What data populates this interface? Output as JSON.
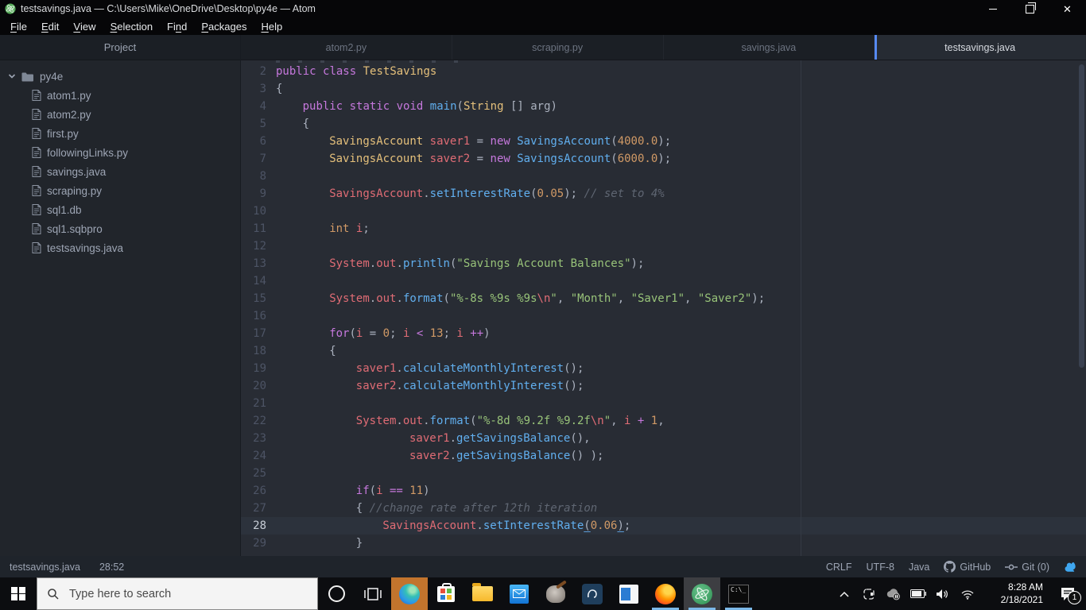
{
  "colors": {
    "accent_tab": "#568af2",
    "taskbar_underline": "#7cb8e8",
    "editor_bg": "#282c34",
    "sidebar_bg": "#21252b",
    "syntax": {
      "keyword": "#c678dd",
      "type": "#e5c07b",
      "function": "#61afef",
      "variable": "#e06c75",
      "number": "#d19a66",
      "string": "#98c379",
      "comment": "#5f6672",
      "plain": "#abb2bf"
    },
    "edge_highlight": "#c2742d",
    "squirrel_icon": "#3fa7f0"
  },
  "window": {
    "title": "testsavings.java — C:\\Users\\Mike\\OneDrive\\Desktop\\py4e — Atom"
  },
  "menu": {
    "items": [
      {
        "label": "File",
        "u": 0
      },
      {
        "label": "Edit",
        "u": 0
      },
      {
        "label": "View",
        "u": 0
      },
      {
        "label": "Selection",
        "u": 0
      },
      {
        "label": "Find",
        "u": 2
      },
      {
        "label": "Packages",
        "u": 0
      },
      {
        "label": "Help",
        "u": 0
      }
    ]
  },
  "sidebar": {
    "header": "Project",
    "root_folder": "py4e",
    "files": [
      "atom1.py",
      "atom2.py",
      "first.py",
      "followingLinks.py",
      "savings.java",
      "scraping.py",
      "sql1.db",
      "sql1.sqbpro",
      "testsavings.java"
    ]
  },
  "tabs": {
    "active": 3,
    "labels": [
      "atom2.py",
      "scraping.py",
      "savings.java",
      "testsavings.java"
    ]
  },
  "editor": {
    "active_line": 28,
    "lines": [
      {
        "n": 2,
        "i": 0,
        "t": [
          [
            "k",
            "public"
          ],
          [
            "p",
            " "
          ],
          [
            "k",
            "class"
          ],
          [
            "p",
            " "
          ],
          [
            "t",
            "TestSavings"
          ]
        ]
      },
      {
        "n": 3,
        "i": 0,
        "t": [
          [
            "p",
            "{"
          ]
        ]
      },
      {
        "n": 4,
        "i": 4,
        "t": [
          [
            "k",
            "public"
          ],
          [
            "p",
            " "
          ],
          [
            "k",
            "static"
          ],
          [
            "p",
            " "
          ],
          [
            "k",
            "void"
          ],
          [
            "p",
            " "
          ],
          [
            "f",
            "main"
          ],
          [
            "p",
            "("
          ],
          [
            "t",
            "String"
          ],
          [
            "p",
            " [] arg)"
          ]
        ]
      },
      {
        "n": 5,
        "i": 4,
        "t": [
          [
            "p",
            "{"
          ]
        ]
      },
      {
        "n": 6,
        "i": 8,
        "t": [
          [
            "t",
            "SavingsAccount"
          ],
          [
            "p",
            " "
          ],
          [
            "v",
            "saver1"
          ],
          [
            "p",
            " = "
          ],
          [
            "k",
            "new"
          ],
          [
            "p",
            " "
          ],
          [
            "f",
            "SavingsAccount"
          ],
          [
            "p",
            "("
          ],
          [
            "n",
            "4000.0"
          ],
          [
            "p",
            ");"
          ]
        ]
      },
      {
        "n": 7,
        "i": 8,
        "t": [
          [
            "t",
            "SavingsAccount"
          ],
          [
            "p",
            " "
          ],
          [
            "v",
            "saver2"
          ],
          [
            "p",
            " = "
          ],
          [
            "k",
            "new"
          ],
          [
            "p",
            " "
          ],
          [
            "f",
            "SavingsAccount"
          ],
          [
            "p",
            "("
          ],
          [
            "n",
            "6000.0"
          ],
          [
            "p",
            ");"
          ]
        ]
      },
      {
        "n": 8,
        "i": 0,
        "t": []
      },
      {
        "n": 9,
        "i": 8,
        "t": [
          [
            "v",
            "SavingsAccount"
          ],
          [
            "p",
            "."
          ],
          [
            "f",
            "setInterestRate"
          ],
          [
            "p",
            "("
          ],
          [
            "n",
            "0.05"
          ],
          [
            "p",
            "); "
          ],
          [
            "c",
            "// set to 4%"
          ]
        ]
      },
      {
        "n": 10,
        "i": 0,
        "t": []
      },
      {
        "n": 11,
        "i": 8,
        "t": [
          [
            "n",
            "int"
          ],
          [
            "p",
            " "
          ],
          [
            "v",
            "i"
          ],
          [
            "p",
            ";"
          ]
        ]
      },
      {
        "n": 12,
        "i": 0,
        "t": []
      },
      {
        "n": 13,
        "i": 8,
        "t": [
          [
            "v",
            "System"
          ],
          [
            "p",
            "."
          ],
          [
            "v",
            "out"
          ],
          [
            "p",
            "."
          ],
          [
            "f",
            "println"
          ],
          [
            "p",
            "("
          ],
          [
            "s",
            "\"Savings Account Balances\""
          ],
          [
            "p",
            ");"
          ]
        ]
      },
      {
        "n": 14,
        "i": 0,
        "t": []
      },
      {
        "n": 15,
        "i": 8,
        "t": [
          [
            "v",
            "System"
          ],
          [
            "p",
            "."
          ],
          [
            "v",
            "out"
          ],
          [
            "p",
            "."
          ],
          [
            "f",
            "format"
          ],
          [
            "p",
            "("
          ],
          [
            "s",
            "\"%-8s %9s %9s"
          ],
          [
            "e",
            "\\n"
          ],
          [
            "s",
            "\""
          ],
          [
            "p",
            ", "
          ],
          [
            "s",
            "\"Month\""
          ],
          [
            "p",
            ", "
          ],
          [
            "s",
            "\"Saver1\""
          ],
          [
            "p",
            ", "
          ],
          [
            "s",
            "\"Saver2\""
          ],
          [
            "p",
            ");"
          ]
        ]
      },
      {
        "n": 16,
        "i": 0,
        "t": []
      },
      {
        "n": 17,
        "i": 8,
        "t": [
          [
            "k",
            "for"
          ],
          [
            "p",
            "("
          ],
          [
            "v",
            "i"
          ],
          [
            "p",
            " = "
          ],
          [
            "n",
            "0"
          ],
          [
            "p",
            "; "
          ],
          [
            "v",
            "i"
          ],
          [
            "p",
            " "
          ],
          [
            "k",
            "<"
          ],
          [
            "p",
            " "
          ],
          [
            "n",
            "13"
          ],
          [
            "p",
            "; "
          ],
          [
            "v",
            "i"
          ],
          [
            "p",
            " "
          ],
          [
            "k",
            "++"
          ],
          [
            "p",
            ")"
          ]
        ]
      },
      {
        "n": 18,
        "i": 8,
        "t": [
          [
            "p",
            "{"
          ]
        ]
      },
      {
        "n": 19,
        "i": 12,
        "t": [
          [
            "v",
            "saver1"
          ],
          [
            "p",
            "."
          ],
          [
            "f",
            "calculateMonthlyInterest"
          ],
          [
            "p",
            "();"
          ]
        ]
      },
      {
        "n": 20,
        "i": 12,
        "t": [
          [
            "v",
            "saver2"
          ],
          [
            "p",
            "."
          ],
          [
            "f",
            "calculateMonthlyInterest"
          ],
          [
            "p",
            "();"
          ]
        ]
      },
      {
        "n": 21,
        "i": 0,
        "t": []
      },
      {
        "n": 22,
        "i": 12,
        "t": [
          [
            "v",
            "System"
          ],
          [
            "p",
            "."
          ],
          [
            "v",
            "out"
          ],
          [
            "p",
            "."
          ],
          [
            "f",
            "format"
          ],
          [
            "p",
            "("
          ],
          [
            "s",
            "\"%-8d %9.2f %9.2f"
          ],
          [
            "e",
            "\\n"
          ],
          [
            "s",
            "\""
          ],
          [
            "p",
            ", "
          ],
          [
            "v",
            "i"
          ],
          [
            "p",
            " "
          ],
          [
            "k",
            "+"
          ],
          [
            "p",
            " "
          ],
          [
            "n",
            "1"
          ],
          [
            "p",
            ","
          ]
        ]
      },
      {
        "n": 23,
        "i": 20,
        "t": [
          [
            "v",
            "saver1"
          ],
          [
            "p",
            "."
          ],
          [
            "f",
            "getSavingsBalance"
          ],
          [
            "p",
            "(),"
          ]
        ]
      },
      {
        "n": 24,
        "i": 20,
        "t": [
          [
            "v",
            "saver2"
          ],
          [
            "p",
            "."
          ],
          [
            "f",
            "getSavingsBalance"
          ],
          [
            "p",
            "() );"
          ]
        ]
      },
      {
        "n": 25,
        "i": 0,
        "t": []
      },
      {
        "n": 26,
        "i": 12,
        "t": [
          [
            "k",
            "if"
          ],
          [
            "p",
            "("
          ],
          [
            "v",
            "i"
          ],
          [
            "p",
            " "
          ],
          [
            "k",
            "=="
          ],
          [
            "p",
            " "
          ],
          [
            "n",
            "11"
          ],
          [
            "p",
            ")"
          ]
        ]
      },
      {
        "n": 27,
        "i": 12,
        "t": [
          [
            "p",
            "{ "
          ],
          [
            "c",
            "//change rate after 12th iteration"
          ]
        ]
      },
      {
        "n": 28,
        "i": 16,
        "t": [
          [
            "v",
            "SavingsAccount"
          ],
          [
            "p",
            "."
          ],
          [
            "f",
            "setInterestRate"
          ],
          [
            "p",
            "(",
            "u"
          ],
          [
            "n",
            "0.06"
          ],
          [
            "p",
            ")",
            "u"
          ],
          [
            "p",
            ";"
          ]
        ]
      },
      {
        "n": 29,
        "i": 12,
        "t": [
          [
            "p",
            "}"
          ]
        ]
      }
    ]
  },
  "status": {
    "file": "testsavings.java",
    "cursor": "28:52",
    "items": [
      "CRLF",
      "UTF-8",
      "Java"
    ],
    "github_label": "GitHub",
    "git_label": "Git (0)"
  },
  "taskbar": {
    "search_placeholder": "Type here to search",
    "clock_time": "8:28 AM",
    "clock_date": "2/18/2021",
    "notification_badge": "1"
  }
}
